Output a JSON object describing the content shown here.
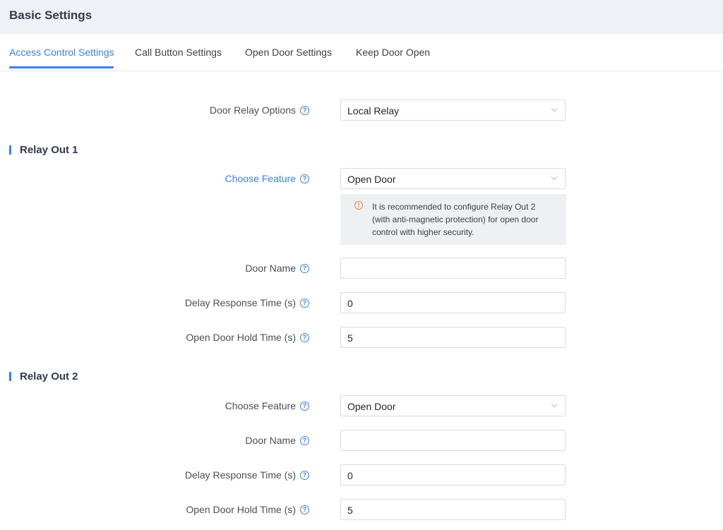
{
  "header": {
    "title": "Basic Settings"
  },
  "tabs": [
    {
      "label": "Access Control Settings"
    },
    {
      "label": "Call Button Settings"
    },
    {
      "label": "Open Door Settings"
    },
    {
      "label": "Keep Door Open"
    }
  ],
  "door_relay": {
    "label": "Door Relay Options",
    "value": "Local Relay"
  },
  "relay1": {
    "title": "Relay Out 1",
    "feature_label": "Choose Feature",
    "feature_value": "Open Door",
    "notice": "It is recommended to configure Relay Out 2 (with anti-magnetic protection) for open door control with higher security.",
    "door_name_label": "Door Name",
    "door_name_value": "",
    "delay_label": "Delay Response Time (s)",
    "delay_value": "0",
    "hold_label": "Open Door Hold Time (s)",
    "hold_value": "5"
  },
  "relay2": {
    "title": "Relay Out 2",
    "feature_label": "Choose Feature",
    "feature_value": "Open Door",
    "door_name_label": "Door Name",
    "door_name_value": "",
    "delay_label": "Delay Response Time (s)",
    "delay_value": "0",
    "hold_label": "Open Door Hold Time (s)",
    "hold_value": "5"
  },
  "icons": {
    "help": "question-circle-icon",
    "warning": "exclamation-circle-icon"
  },
  "colors": {
    "accent": "#3a7fe6",
    "warning": "#e8833a",
    "header_bg": "#eef1f6"
  }
}
